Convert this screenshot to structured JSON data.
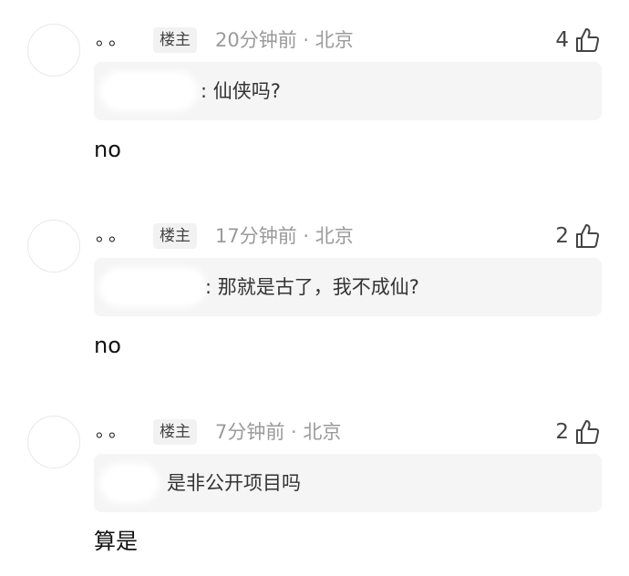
{
  "comments": [
    {
      "username": "。。",
      "op_badge": "楼主",
      "meta": "20分钟前 · 北京",
      "likes": "4",
      "quote_text": ": 仙侠吗?",
      "reply": "no"
    },
    {
      "username": "。。",
      "op_badge": "楼主",
      "meta": "17分钟前 · 北京",
      "likes": "2",
      "quote_text": ": 那就是古了，我不成仙?",
      "reply": "no"
    },
    {
      "username": "。。",
      "op_badge": "楼主",
      "meta": "7分钟前 · 北京",
      "likes": "2",
      "quote_text": "是非公开项目吗",
      "reply": "算是"
    }
  ],
  "icons": {
    "like": "thumbs-up-icon"
  },
  "colors": {
    "quote_bg": "#f5f5f5",
    "meta_text": "#9a9a9a",
    "badge_bg": "#f2f2f2"
  }
}
